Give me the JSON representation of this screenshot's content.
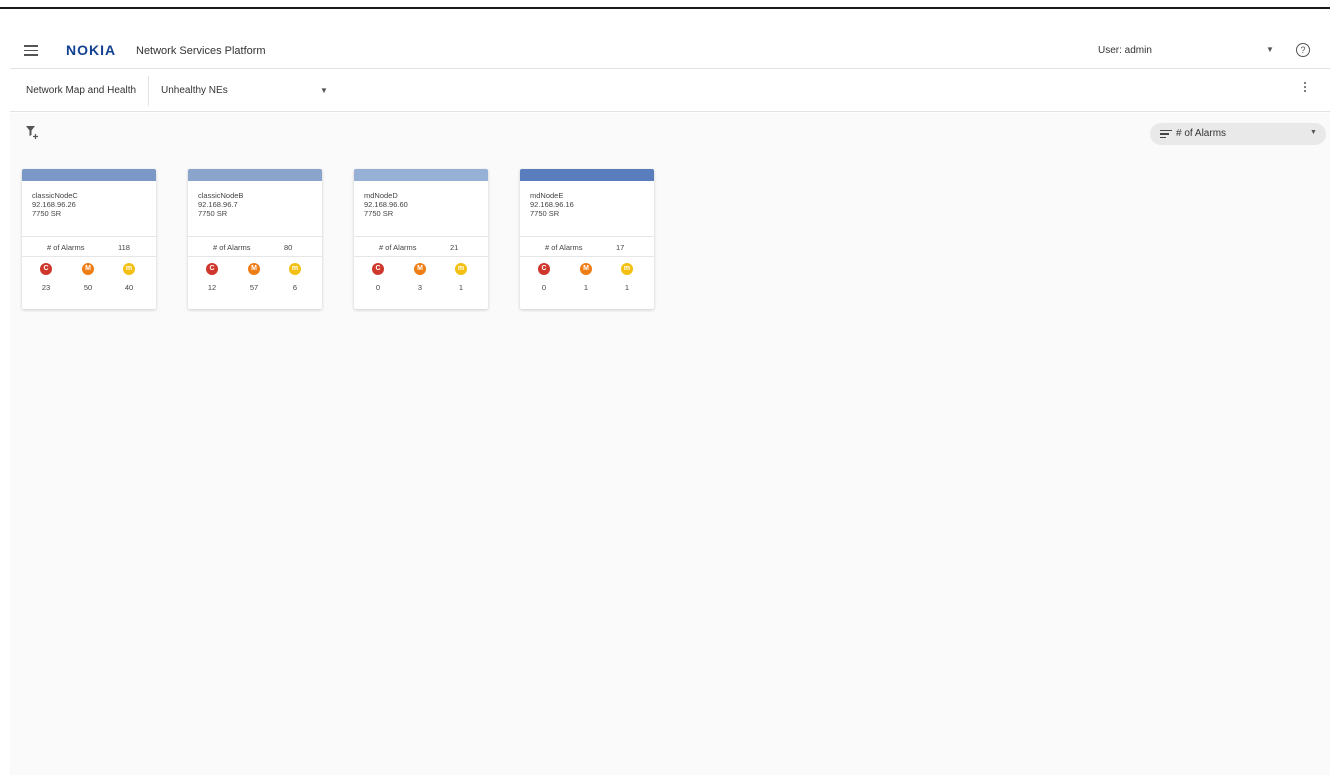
{
  "header": {
    "logo_text": "NOKIA",
    "app_title": "Network Services Platform",
    "user_label": "User: admin",
    "menu_icon": "hamburger-menu-icon",
    "help_icon": "help-circle-icon",
    "help_glyph": "?"
  },
  "subbar": {
    "breadcrumb": "Network Map and Health",
    "view_selected": "Unhealthy NEs"
  },
  "toolbar": {
    "filter_icon": "filter-add-icon",
    "sort_label": "# of Alarms",
    "sort_icon": "sort-icon"
  },
  "colors": {
    "brand": "#124191",
    "critical": "#d0372c",
    "major": "#ef7d16",
    "minor": "#f3bf12"
  },
  "severity_labels": {
    "critical": "C",
    "major": "M",
    "minor": "m"
  },
  "cards": [
    {
      "name": "classicNodeC",
      "ip": "92.168.96.26",
      "model": "7750 SR",
      "alarms_label": "# of Alarms",
      "alarms_total": "118",
      "critical": "23",
      "major": "50",
      "minor": "40",
      "bar_color": "#7b98c6"
    },
    {
      "name": "classicNodeB",
      "ip": "92.168.96.7",
      "model": "7750 SR",
      "alarms_label": "# of Alarms",
      "alarms_total": "80",
      "critical": "12",
      "major": "57",
      "minor": "6",
      "bar_color": "#8aa4cc"
    },
    {
      "name": "mdNodeD",
      "ip": "92.168.96.60",
      "model": "7750 SR",
      "alarms_label": "# of Alarms",
      "alarms_total": "21",
      "critical": "0",
      "major": "3",
      "minor": "1",
      "bar_color": "#97b0d5"
    },
    {
      "name": "mdNodeE",
      "ip": "92.168.96.16",
      "model": "7750 SR",
      "alarms_label": "# of Alarms",
      "alarms_total": "17",
      "critical": "0",
      "major": "1",
      "minor": "1",
      "bar_color": "#5a7dbd"
    }
  ]
}
